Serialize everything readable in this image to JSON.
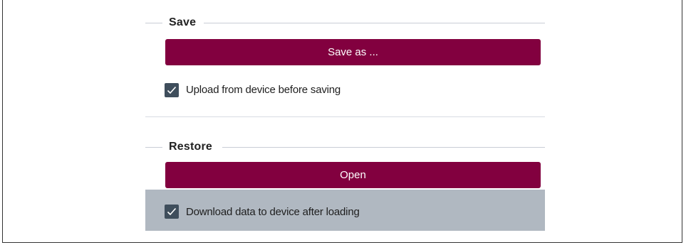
{
  "save_section": {
    "title": "Save",
    "button_label": "Save as ...",
    "checkbox": {
      "label": "Upload from device before saving",
      "checked": true
    }
  },
  "restore_section": {
    "title": "Restore",
    "button_label": "Open",
    "checkbox": {
      "label": "Download data to device after loading",
      "checked": true
    }
  },
  "colors": {
    "button_bg": "#82003f",
    "button_text": "#ffffff",
    "checkbox_fill": "#3f4e5c",
    "highlight_row": "#b0b8c1",
    "rule": "#c9ccd6"
  },
  "icons": {
    "checkmark": "checkmark-icon"
  }
}
